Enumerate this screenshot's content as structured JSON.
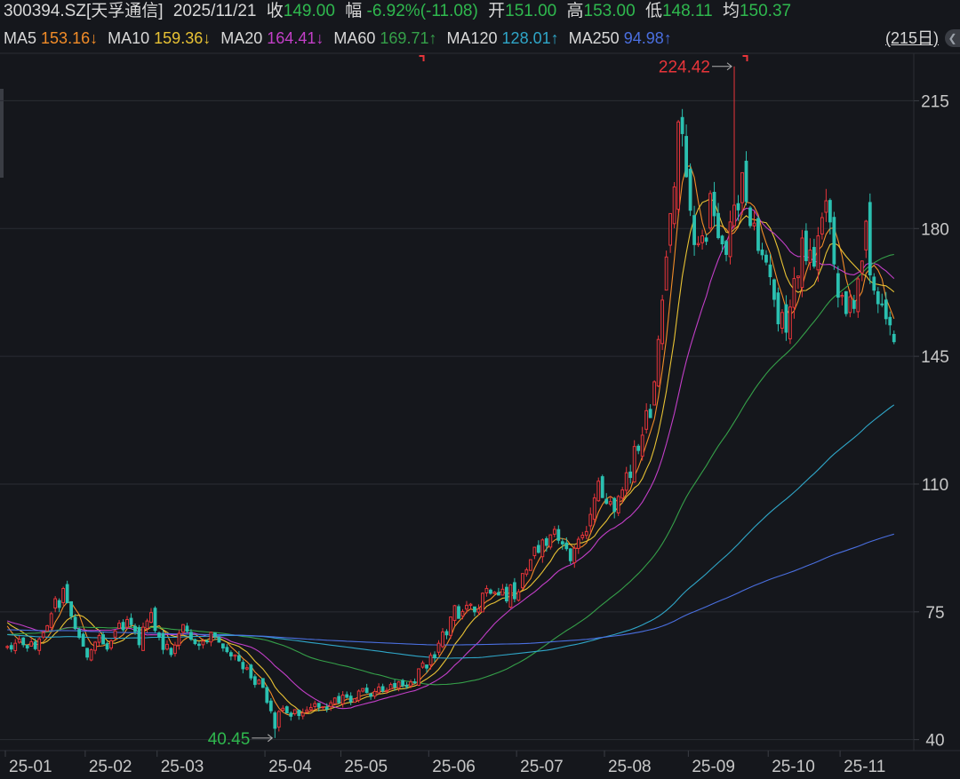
{
  "header": {
    "ticker": "300394.SZ[天孚通信]",
    "date": "2025/11/21",
    "close_label": "收",
    "close_value": "149.00",
    "change_label": "幅",
    "change_value": "-6.92%(-11.08)",
    "open_label": "开",
    "open_value": "151.00",
    "high_label": "高",
    "high_value": "153.00",
    "low_label": "低",
    "low_value": "148.11",
    "avg_label": "均",
    "avg_value": "150.37"
  },
  "ma_legend": [
    {
      "label": "MA5",
      "value": "153.16↓",
      "color": "#f28c28"
    },
    {
      "label": "MA10",
      "value": "159.36↓",
      "color": "#e8c234"
    },
    {
      "label": "MA20",
      "value": "164.41↓",
      "color": "#c33fc8"
    },
    {
      "label": "MA60",
      "value": "169.71↑",
      "color": "#35a049"
    },
    {
      "label": "MA120",
      "value": "128.01↑",
      "color": "#2fa6c8"
    },
    {
      "label": "MA250",
      "value": "94.98↑",
      "color": "#4a6fe0"
    }
  ],
  "period_button": "(215日)",
  "colors": {
    "up": "#e8353a",
    "down": "#2bc0b0",
    "background": "#15171c",
    "grid": "#2a2d33",
    "high_label": "#e8353a",
    "low_label": "#2fb84e"
  },
  "chart_data": {
    "type": "candlestick",
    "y_ticks": [
      215,
      180,
      145,
      110,
      75,
      40
    ],
    "x_tick_labels": [
      "25-01",
      "25-02",
      "25-03",
      "25-04",
      "25-05",
      "25-06",
      "25-07",
      "25-08",
      "25-09",
      "25-10",
      "25-11"
    ],
    "x_tick_index": [
      0,
      20,
      38,
      65,
      84,
      106,
      128,
      150,
      171,
      191,
      209
    ],
    "ylim": [
      37,
      228
    ],
    "annotations": {
      "high": {
        "label": "224.42",
        "value": 224.42,
        "index": 182
      },
      "low": {
        "label": "40.45",
        "value": 40.45,
        "index": 67
      }
    },
    "close": [
      65.5,
      64.8,
      66.4,
      67.5,
      66.0,
      65.1,
      66.8,
      64.9,
      67.6,
      69.3,
      71.2,
      74.5,
      78.6,
      76.2,
      81.4,
      77.5,
      73.8,
      70.4,
      68.0,
      65.6,
      62.6,
      64.6,
      66.7,
      68.5,
      66.2,
      64.8,
      67.1,
      69.8,
      71.9,
      70.1,
      72.9,
      71.5,
      69.6,
      66.0,
      70.8,
      72.5,
      74.8,
      69.9,
      68.1,
      64.7,
      66.1,
      63.3,
      65.9,
      69.1,
      71.5,
      69.7,
      67.5,
      66.3,
      65.8,
      67.0,
      66.8,
      69.4,
      68.2,
      66.7,
      65.1,
      64.1,
      62.9,
      63.2,
      61.6,
      59.4,
      59.7,
      56.9,
      55.1,
      56.3,
      54.3,
      50.2,
      47.9,
      43.1,
      47.7,
      48.6,
      47.3,
      46.4,
      48.2,
      46.6,
      47.3,
      48.1,
      48.8,
      49.9,
      48.9,
      49.0,
      48.4,
      50.1,
      51.4,
      50.1,
      52.2,
      51.6,
      50.4,
      51.2,
      53.3,
      54.0,
      52.9,
      51.9,
      53.2,
      54.4,
      53.3,
      53.5,
      55.1,
      54.4,
      55.8,
      54.8,
      54.5,
      55.8,
      55.6,
      59.4,
      61.0,
      59.6,
      63.1,
      62.4,
      66.4,
      69.5,
      68.7,
      73.6,
      76.7,
      73.2,
      75.1,
      76.8,
      77.1,
      75.0,
      75.8,
      80.1,
      81.4,
      80.1,
      80.4,
      79.6,
      81.2,
      78.0,
      82.4,
      78.6,
      80.5,
      85.5,
      86.5,
      89.3,
      92.7,
      91.3,
      94.7,
      93.2,
      96.1,
      97.6,
      94.6,
      93.6,
      92.3,
      89.0,
      92.4,
      94.9,
      96.0,
      97.0,
      101.7,
      106.2,
      110.8,
      106.3,
      104.7,
      105.2,
      102.5,
      106.6,
      108.4,
      113.1,
      111.8,
      120.3,
      119.2,
      123.4,
      130.1,
      128.2,
      138.0,
      149.6,
      160.4,
      172.2,
      184.1,
      191.4,
      209.2,
      206.0,
      194.2,
      185.0,
      175.6,
      175.9,
      178.0,
      176.5,
      189.6,
      183.5,
      177.5,
      175.8,
      172.9,
      181.8,
      186.4,
      185.1,
      195.3,
      187.4,
      180.8,
      181.5,
      174.0,
      172.8,
      170.8,
      166.8,
      160.6,
      153.9,
      157.0,
      151.6,
      158.5,
      166.3,
      167.0,
      177.4,
      171.2,
      174.1,
      169.7,
      178.0,
      183.0,
      187.6,
      181.8,
      170.3,
      161.2,
      161.7,
      156.7,
      161.3,
      158.1,
      166.2,
      171.1,
      182.0,
      167.3,
      163.1,
      159.4,
      159.2,
      155.3,
      153.6,
      149.0
    ]
  }
}
